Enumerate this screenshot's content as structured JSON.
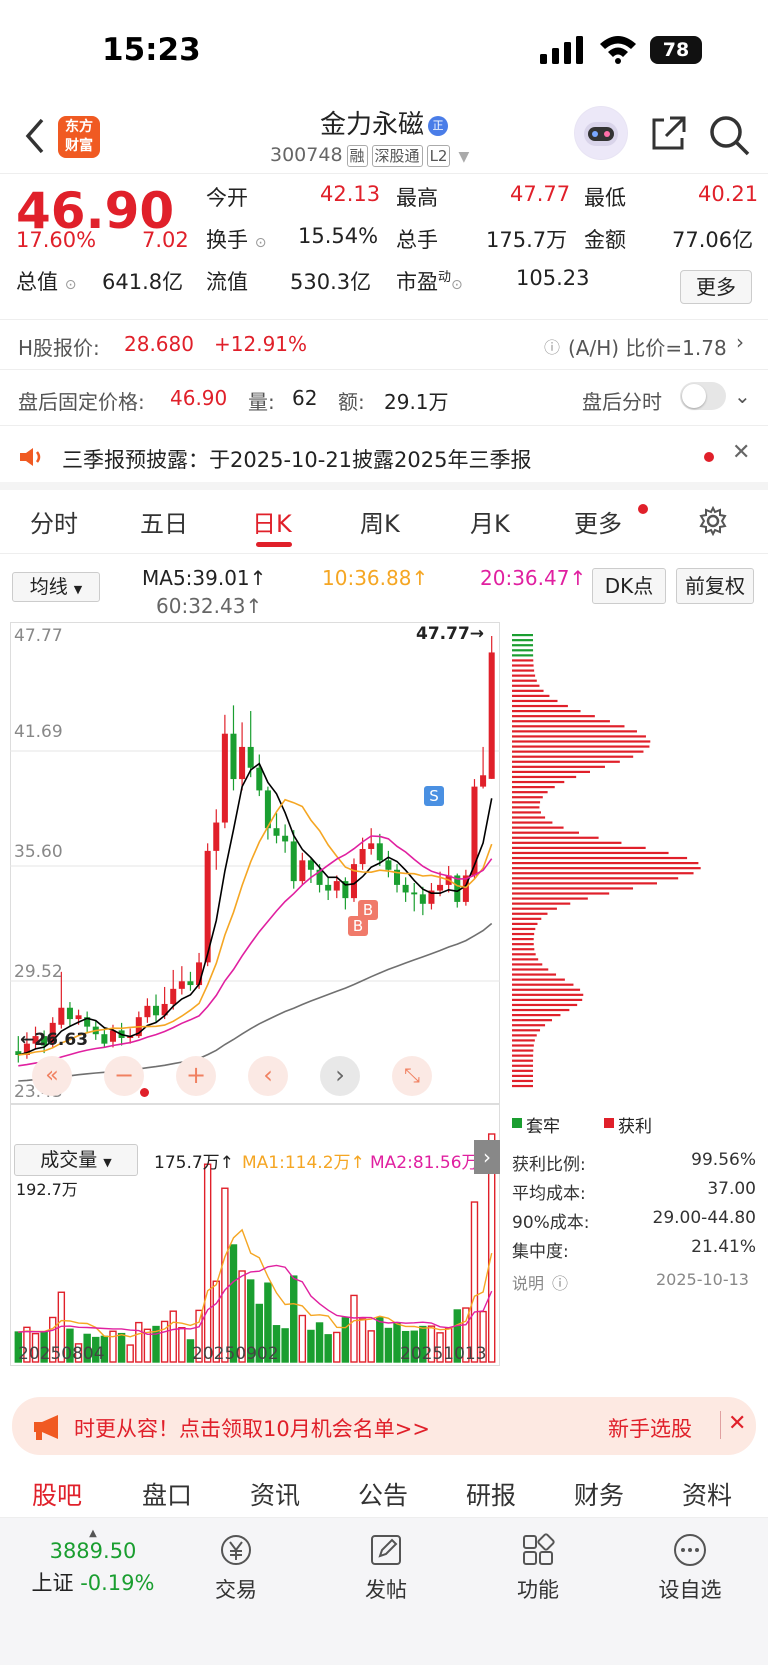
{
  "status": {
    "time": "15:23",
    "battery": "78"
  },
  "header": {
    "logo_line1": "东方",
    "logo_line2": "财富",
    "name": "金力永磁",
    "zheng": "正",
    "code": "300748",
    "tags": [
      "融",
      "深股通",
      "L2"
    ]
  },
  "quote": {
    "price": "46.90",
    "pct": "17.60%",
    "chg": "7.02",
    "open_l": "今开",
    "open": "42.13",
    "high_l": "最高",
    "high": "47.77",
    "low_l": "最低",
    "low": "40.21",
    "turn_l": "换手",
    "turn": "15.54%",
    "vol_l": "总手",
    "vol": "175.7万",
    "amt_l": "金额",
    "amt": "77.06亿",
    "mcap_l": "总值",
    "mcap": "641.8亿",
    "float_l": "流值",
    "float": "530.3亿",
    "pe_l": "市盈",
    "pe_sup": "动",
    "pe": "105.23",
    "more": "更多"
  },
  "hshare": {
    "label": "H股报价:",
    "price": "28.680",
    "pct": "+12.91%",
    "ratio": "(A/H) 比价=1.78"
  },
  "afterhours": {
    "label": "盘后固定价格:",
    "price": "46.90",
    "vol_l": "量:",
    "vol": "62",
    "amt_l": "额:",
    "amt": "29.1万",
    "toggle_label": "盘后分时"
  },
  "notice": {
    "text": "三季报预披露：于2025-10-21披露2025年三季报"
  },
  "tabs": [
    "分时",
    "五日",
    "日K",
    "周K",
    "月K",
    "更多"
  ],
  "ma": {
    "select": "均线",
    "ma5": "MA5:39.01↑",
    "ma10": "10:36.88↑",
    "ma20": "20:36.47↑",
    "ma60": "60:32.43↑",
    "dk": "DK点",
    "fq": "前复权"
  },
  "kline": {
    "axis": [
      "47.77",
      "41.69",
      "35.60",
      "29.52",
      "23.43"
    ],
    "high_mark": "47.77→",
    "low_mark": "←26.63",
    "s": "S",
    "b": "B"
  },
  "volume": {
    "select": "成交量",
    "total": "175.7万↑",
    "ma1": "MA1:114.2万↑",
    "ma2": "MA2:81.56万",
    "max": "192.7万",
    "dates": [
      "20250804",
      "20250902",
      "20251013"
    ]
  },
  "chips": {
    "legend_trap": "套牢",
    "legend_profit": "获利",
    "rows": [
      {
        "k": "获利比例:",
        "v": "99.56%"
      },
      {
        "k": "平均成本:",
        "v": "37.00"
      },
      {
        "k": "90%成本:",
        "v": "29.00-44.80"
      },
      {
        "k": "集中度:",
        "v": "21.41%"
      }
    ],
    "note": "说明",
    "date": "2025-10-13"
  },
  "banner": {
    "text": "时更从容！点击领取10月机会名单>>",
    "right": "新手选股"
  },
  "bottom_tabs": [
    "股吧",
    "盘口",
    "资讯",
    "公告",
    "研报",
    "财务",
    "资料"
  ],
  "footer": {
    "index_val": "3889.50",
    "index_name": "上证",
    "index_pct": "-0.19%",
    "items": [
      "交易",
      "发帖",
      "功能",
      "设自选"
    ]
  },
  "colors": {
    "up": "#e0202a",
    "down": "#1a9e30",
    "ma5": "#000000",
    "ma10": "#f5a623",
    "ma20": "#e020a0",
    "ma60": "#707070"
  },
  "chart_data": {
    "type": "candlestick",
    "candles": [
      [
        25.8,
        25.6,
        26.6,
        25.2
      ],
      [
        25.6,
        26.2,
        26.8,
        25.4
      ],
      [
        26.2,
        26.6,
        27.1,
        25.9
      ],
      [
        26.6,
        26.1,
        26.9,
        25.7
      ],
      [
        26.2,
        27.3,
        27.6,
        26.0
      ],
      [
        27.2,
        28.1,
        30.0,
        27.0
      ],
      [
        28.1,
        27.5,
        28.4,
        27.1
      ],
      [
        27.5,
        27.7,
        28.0,
        27.2
      ],
      [
        27.6,
        27.1,
        27.9,
        26.8
      ],
      [
        27.1,
        26.7,
        27.4,
        26.4
      ],
      [
        26.7,
        26.2,
        27.0,
        26.0
      ],
      [
        26.3,
        26.9,
        27.2,
        26.0
      ],
      [
        26.9,
        26.5,
        27.3,
        26.1
      ],
      [
        26.5,
        26.6,
        27.0,
        26.2
      ],
      [
        26.6,
        27.6,
        27.9,
        26.5
      ],
      [
        27.6,
        28.2,
        28.6,
        27.3
      ],
      [
        28.2,
        27.7,
        28.8,
        27.3
      ],
      [
        27.7,
        28.3,
        29.2,
        27.5
      ],
      [
        28.3,
        29.1,
        30.1,
        28.0
      ],
      [
        29.1,
        29.5,
        30.3,
        28.8
      ],
      [
        29.5,
        29.3,
        30.0,
        29.0
      ],
      [
        29.3,
        30.5,
        31.0,
        29.1
      ],
      [
        30.5,
        36.4,
        36.8,
        30.3
      ],
      [
        36.4,
        37.9,
        38.6,
        35.4
      ],
      [
        37.9,
        42.6,
        43.6,
        37.6
      ],
      [
        42.6,
        40.2,
        44.1,
        39.6
      ],
      [
        40.2,
        41.9,
        43.2,
        39.6
      ],
      [
        41.9,
        40.8,
        43.8,
        40.3
      ],
      [
        40.8,
        39.6,
        41.5,
        39.3
      ],
      [
        39.6,
        37.6,
        39.8,
        37.0
      ],
      [
        37.6,
        37.2,
        38.4,
        36.8
      ],
      [
        37.2,
        36.9,
        37.8,
        36.3
      ],
      [
        36.9,
        34.8,
        37.5,
        34.4
      ],
      [
        34.8,
        35.9,
        36.3,
        34.6
      ],
      [
        35.9,
        35.4,
        36.0,
        34.7
      ],
      [
        35.4,
        34.6,
        35.7,
        34.2
      ],
      [
        34.6,
        34.3,
        35.0,
        33.8
      ],
      [
        34.3,
        34.8,
        35.1,
        33.9
      ],
      [
        34.8,
        33.9,
        35.0,
        33.3
      ],
      [
        33.9,
        35.7,
        36.0,
        33.7
      ],
      [
        35.7,
        36.5,
        37.1,
        35.4
      ],
      [
        36.5,
        36.8,
        37.6,
        36.2
      ],
      [
        36.8,
        35.9,
        37.3,
        35.6
      ],
      [
        35.9,
        35.4,
        36.4,
        35.0
      ],
      [
        35.4,
        34.6,
        35.7,
        34.2
      ],
      [
        34.6,
        34.2,
        35.0,
        33.7
      ],
      [
        34.2,
        34.1,
        34.7,
        33.2
      ],
      [
        34.1,
        33.6,
        34.5,
        33.0
      ],
      [
        33.6,
        34.3,
        34.7,
        33.3
      ],
      [
        34.3,
        34.6,
        35.3,
        34.0
      ],
      [
        34.6,
        35.1,
        35.6,
        34.2
      ],
      [
        35.1,
        33.7,
        35.2,
        33.4
      ],
      [
        33.7,
        35.1,
        35.4,
        33.5
      ],
      [
        35.1,
        39.8,
        40.2,
        34.9
      ],
      [
        39.8,
        40.4,
        41.9,
        39.7
      ],
      [
        40.21,
        46.9,
        47.77,
        40.21
      ]
    ],
    "ylim": [
      23.43,
      47.77
    ],
    "dates": [
      "20250804",
      "20250902",
      "20251013"
    ],
    "volume_max": "192.7万"
  }
}
